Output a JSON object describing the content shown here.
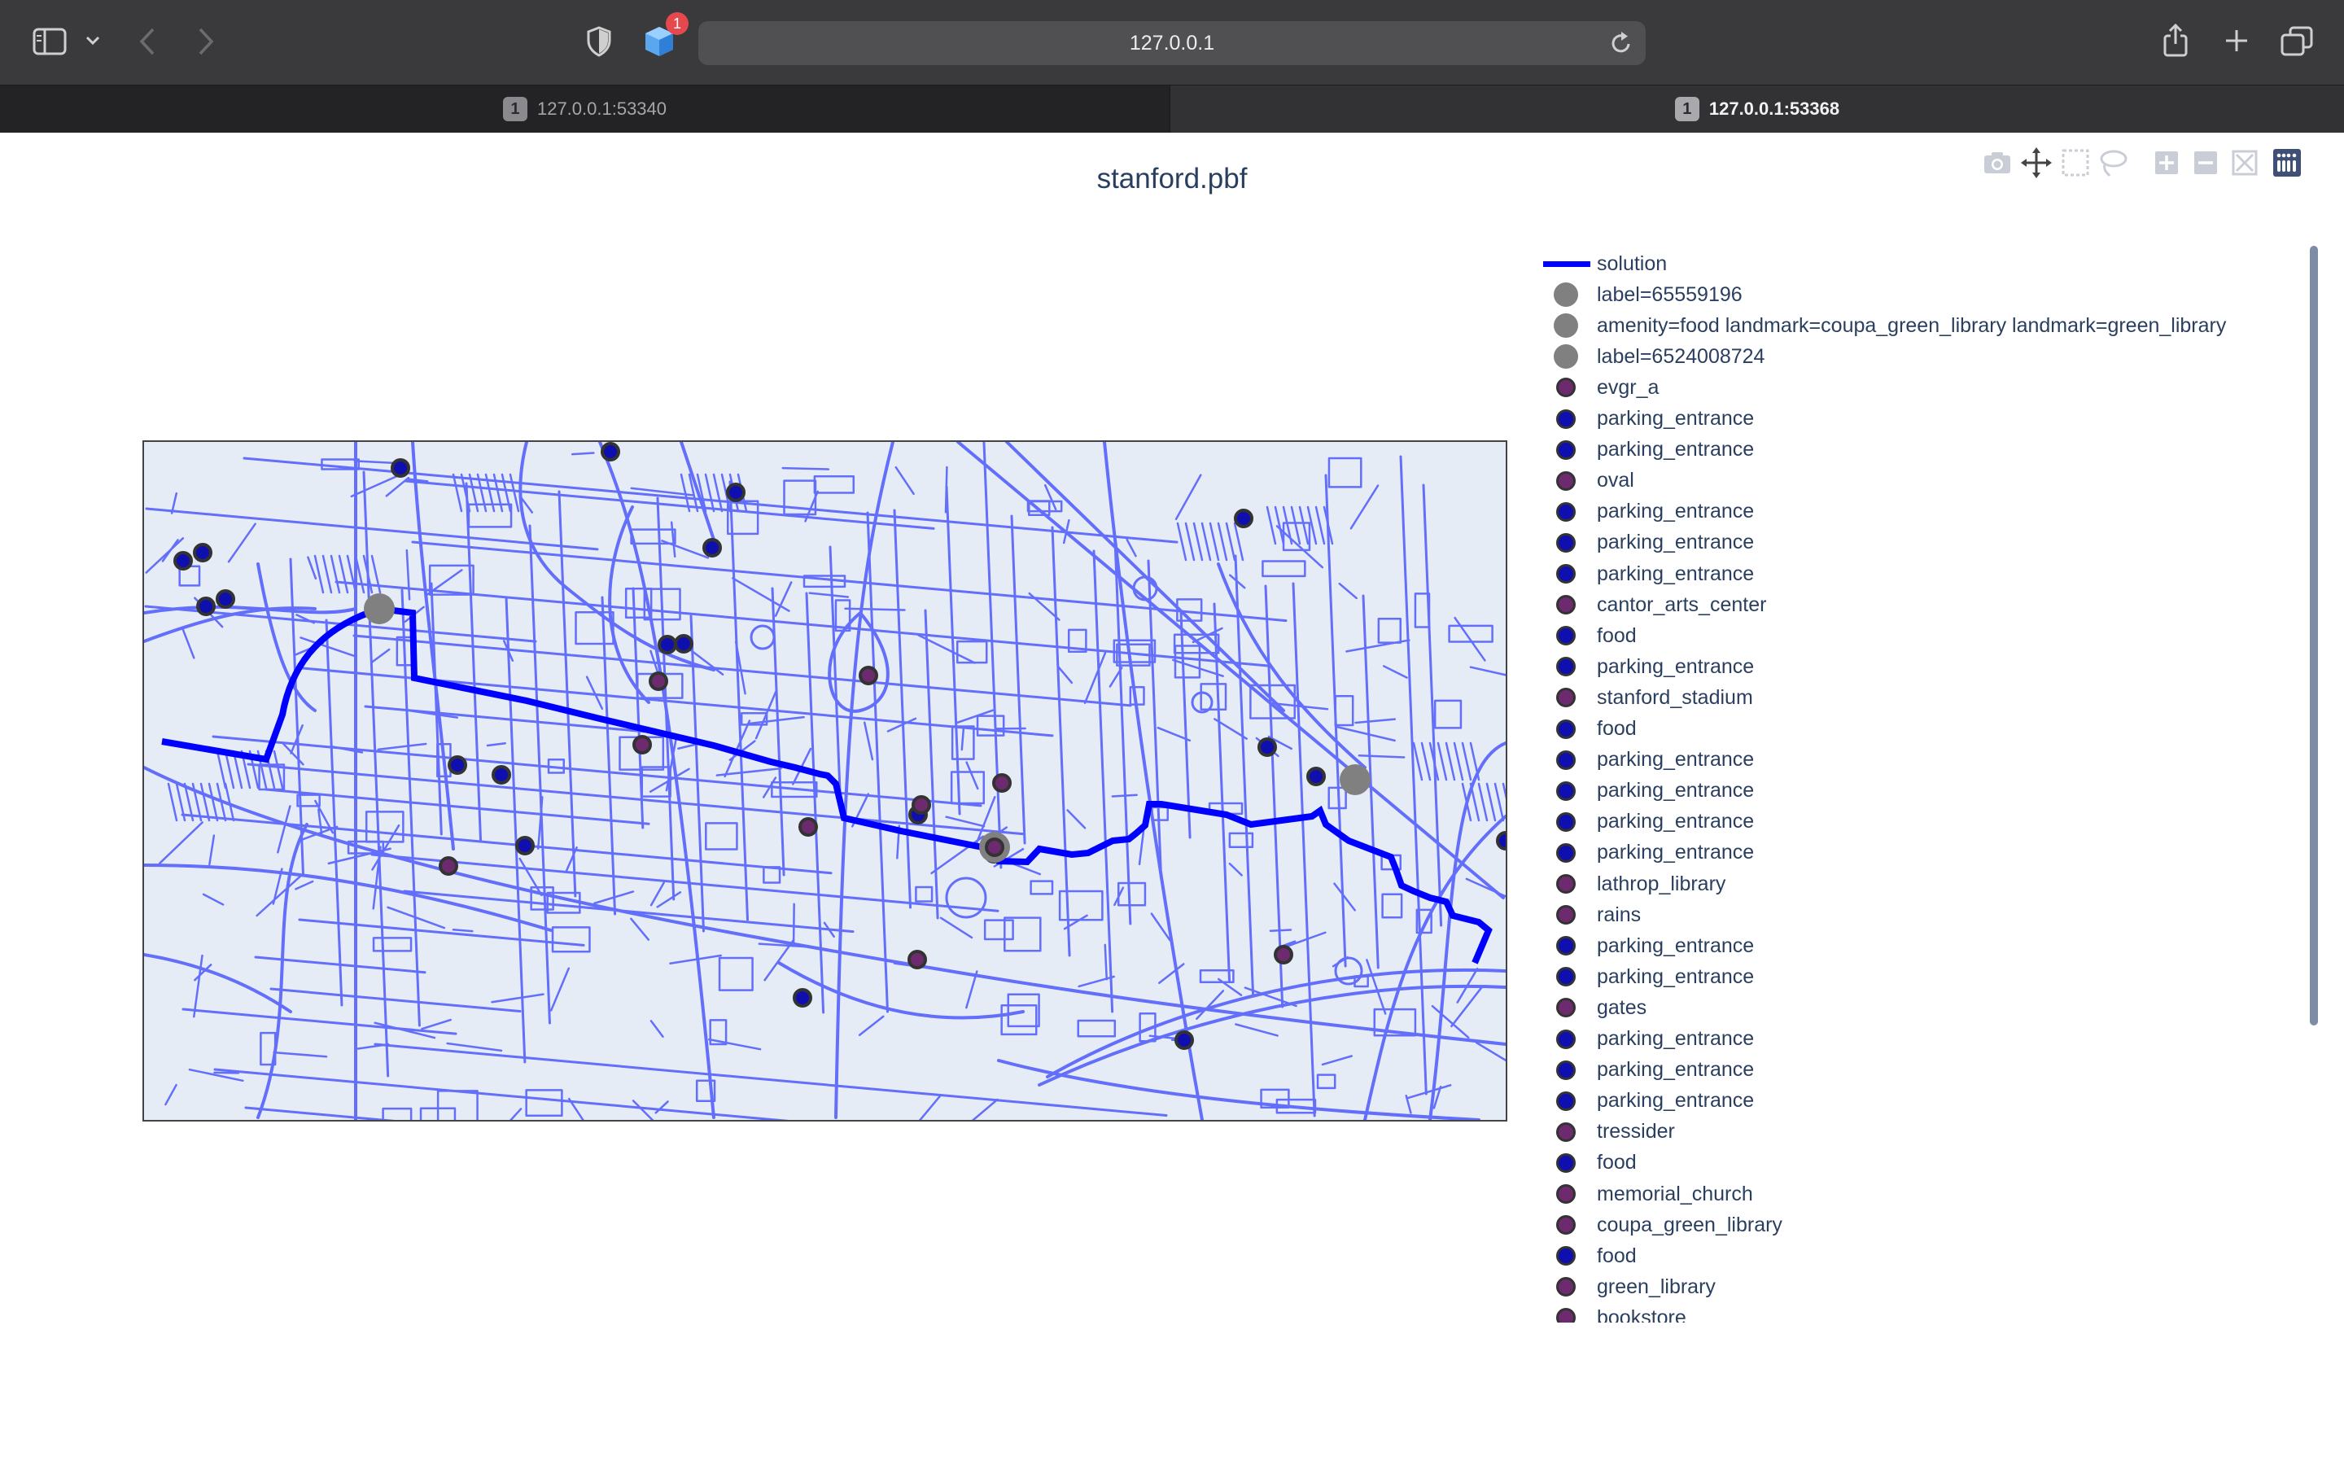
{
  "browser": {
    "url": "127.0.0.1",
    "extension_badge": "1",
    "tabs": [
      {
        "number": "1",
        "label": "127.0.0.1:53340",
        "active": false
      },
      {
        "number": "1",
        "label": "127.0.0.1:53368",
        "active": true
      }
    ],
    "icons": [
      "sidebar-icon",
      "chevron-down-icon",
      "back-icon",
      "forward-icon",
      "shield-icon",
      "extension-cube-icon",
      "reload-icon",
      "share-icon",
      "new-tab-icon",
      "tab-overview-icon"
    ]
  },
  "plot": {
    "title": "stanford.pbf",
    "modebar": [
      "camera-icon",
      "pan-icon",
      "box-select-icon",
      "lasso-icon",
      "zoom-in-icon",
      "zoom-out-icon",
      "autoscale-icon",
      "plotly-logo-icon"
    ],
    "colors": {
      "road": "#636efa",
      "solution": "#0000ff",
      "landmark": "#6e2a6e",
      "parking": "#0f0fb0",
      "endpoint": "#808080",
      "map_background": "#e5ecf6"
    }
  },
  "legend": {
    "items": [
      {
        "label": "solution",
        "kind": "line",
        "color": "#0000ff"
      },
      {
        "label": "label=65559196",
        "kind": "big",
        "color": "#808080"
      },
      {
        "label": "amenity=food landmark=coupa_green_library landmark=green_library",
        "kind": "big",
        "color": "#808080"
      },
      {
        "label": "label=6524008724",
        "kind": "big",
        "color": "#808080"
      },
      {
        "label": "evgr_a",
        "kind": "dot",
        "color": "#6e2a6e"
      },
      {
        "label": "parking_entrance",
        "kind": "dot",
        "color": "#0f0fb0"
      },
      {
        "label": "parking_entrance",
        "kind": "dot",
        "color": "#0f0fb0"
      },
      {
        "label": "oval",
        "kind": "dot",
        "color": "#6e2a6e"
      },
      {
        "label": "parking_entrance",
        "kind": "dot",
        "color": "#0f0fb0"
      },
      {
        "label": "parking_entrance",
        "kind": "dot",
        "color": "#0f0fb0"
      },
      {
        "label": "parking_entrance",
        "kind": "dot",
        "color": "#0f0fb0"
      },
      {
        "label": "cantor_arts_center",
        "kind": "dot",
        "color": "#6e2a6e"
      },
      {
        "label": "food",
        "kind": "dot",
        "color": "#0f0fb0"
      },
      {
        "label": "parking_entrance",
        "kind": "dot",
        "color": "#0f0fb0"
      },
      {
        "label": "stanford_stadium",
        "kind": "dot",
        "color": "#6e2a6e"
      },
      {
        "label": "food",
        "kind": "dot",
        "color": "#0f0fb0"
      },
      {
        "label": "parking_entrance",
        "kind": "dot",
        "color": "#0f0fb0"
      },
      {
        "label": "parking_entrance",
        "kind": "dot",
        "color": "#0f0fb0"
      },
      {
        "label": "parking_entrance",
        "kind": "dot",
        "color": "#0f0fb0"
      },
      {
        "label": "parking_entrance",
        "kind": "dot",
        "color": "#0f0fb0"
      },
      {
        "label": "lathrop_library",
        "kind": "dot",
        "color": "#6e2a6e"
      },
      {
        "label": "rains",
        "kind": "dot",
        "color": "#6e2a6e"
      },
      {
        "label": "parking_entrance",
        "kind": "dot",
        "color": "#0f0fb0"
      },
      {
        "label": "parking_entrance",
        "kind": "dot",
        "color": "#0f0fb0"
      },
      {
        "label": "gates",
        "kind": "dot",
        "color": "#6e2a6e"
      },
      {
        "label": "parking_entrance",
        "kind": "dot",
        "color": "#0f0fb0"
      },
      {
        "label": "parking_entrance",
        "kind": "dot",
        "color": "#0f0fb0"
      },
      {
        "label": "parking_entrance",
        "kind": "dot",
        "color": "#0f0fb0"
      },
      {
        "label": "tressider",
        "kind": "dot",
        "color": "#6e2a6e"
      },
      {
        "label": "food",
        "kind": "dot",
        "color": "#0f0fb0"
      },
      {
        "label": "memorial_church",
        "kind": "dot",
        "color": "#6e2a6e"
      },
      {
        "label": "coupa_green_library",
        "kind": "dot",
        "color": "#6e2a6e"
      },
      {
        "label": "food",
        "kind": "dot",
        "color": "#0f0fb0"
      },
      {
        "label": "green_library",
        "kind": "dot",
        "color": "#6e2a6e"
      },
      {
        "label": "bookstore",
        "kind": "dot",
        "color": "#6e2a6e"
      }
    ]
  }
}
